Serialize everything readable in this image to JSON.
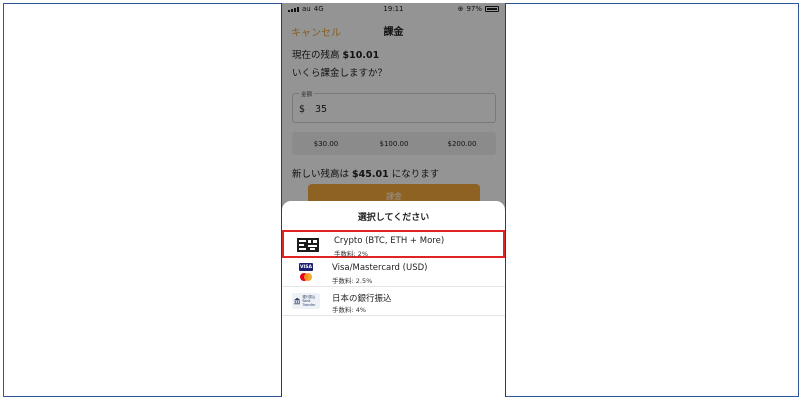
{
  "status_bar": {
    "carrier": "au",
    "network": "4G",
    "time": "19:11",
    "battery": "97%"
  },
  "nav": {
    "cancel_label": "キャンセル",
    "title": "課金"
  },
  "balance": {
    "label": "現在の残高",
    "value": "$10.01"
  },
  "question": "いくら課金しますか？",
  "amount_field": {
    "label": "金額",
    "currency": "$",
    "value": "35"
  },
  "presets": [
    "$30.00",
    "$100.00",
    "$200.00"
  ],
  "new_balance": {
    "prefix": "新しい残高は",
    "value": "$45.01",
    "suffix": "になります"
  },
  "payment_sheet": {
    "title": "選択してください",
    "options": [
      {
        "name": "Crypto (BTC, ETH + More)",
        "fee": "手数料: 2%",
        "icon": "crypto-icon",
        "selected": true
      },
      {
        "name": "Visa/Mastercard (USD)",
        "fee": "手数料: 2.5%",
        "icon": "visa-mastercard-icon",
        "selected": false
      },
      {
        "name": "日本の銀行振込",
        "fee": "手数料: 4%",
        "icon": "bank-transfer-icon",
        "selected": false,
        "badge_text": [
          "銀行振込",
          "Bank Transfer"
        ]
      }
    ]
  },
  "icon_badges": {
    "visa": "VISA"
  },
  "colors": {
    "accent": "#f5a93d",
    "highlight": "#e02424",
    "frame": "#2f5597"
  }
}
